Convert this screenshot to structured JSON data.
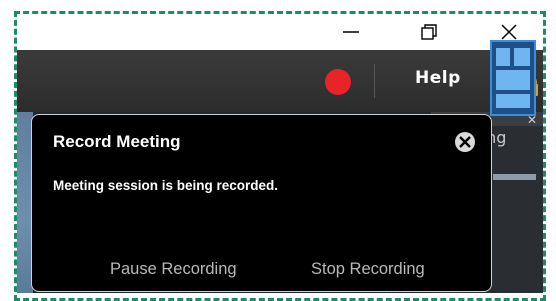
{
  "window": {
    "minimize_icon": "minimize-icon",
    "restore_icon": "restore-icon",
    "close_icon": "close-icon"
  },
  "toolbar": {
    "record_indicator_color": "#e8242a",
    "help_label": "Help",
    "signal_icon": "network-signal-icon"
  },
  "right_panel": {
    "sharing_label": "Sharing"
  },
  "popup": {
    "title": "Record Meeting",
    "message": "Meeting session is being recorded.",
    "pause_label": "Pause Recording",
    "stop_label": "Stop Recording"
  }
}
